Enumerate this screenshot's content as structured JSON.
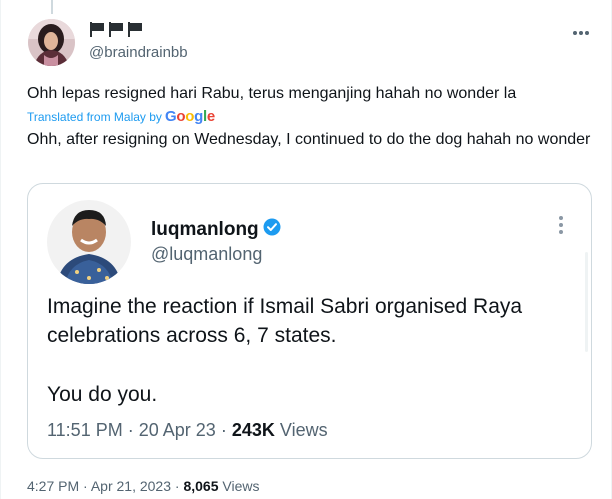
{
  "tweet": {
    "handle": "@braindrainbb",
    "text": "Ohh lepas resigned hari Rabu, terus menganjing hahah no wonder la",
    "translated_prefix": "Translated from Malay by",
    "google_logo": "Google",
    "translation": "Ohh, after resigning on Wednesday, I continued to do the dog hahah no wonder",
    "time": "4:27 PM",
    "date": "Apr 21, 2023",
    "views_count": "8,065",
    "views_label": "Views",
    "separator": "·",
    "display_name_icons": [
      "black-flag-icon",
      "black-flag-icon",
      "black-flag-icon"
    ]
  },
  "quote": {
    "name": "luqmanlong",
    "handle": "@luqmanlong",
    "line1": "Imagine the reaction if Ismail Sabri organised Raya celebrations across 6, 7 states.",
    "line2": "You do you.",
    "time": "11:51 PM",
    "date": "20 Apr 23",
    "views_count": "243K",
    "views_label": "Views",
    "separator": "·"
  },
  "colors": {
    "link": "#1d9bf0",
    "verified": "#1d9bf0",
    "secondary_text": "#536471",
    "primary_text": "#0f1419",
    "border": "#cfd9de"
  }
}
